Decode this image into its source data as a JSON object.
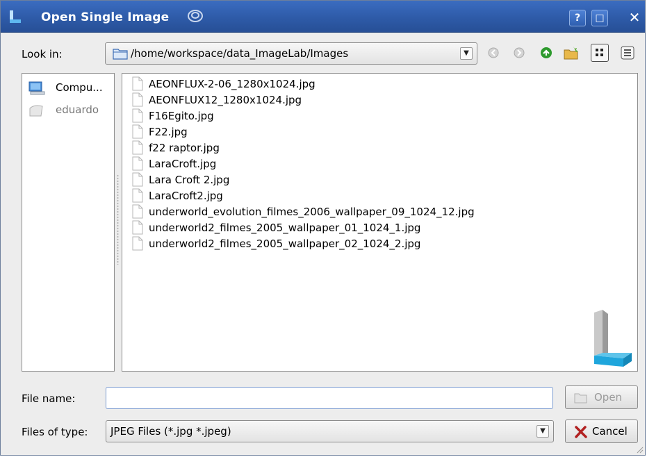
{
  "window": {
    "title": "Open Single Image",
    "help_glyph": "?",
    "max_glyph": "□",
    "close_glyph": "✕"
  },
  "lookin": {
    "label": "Look in:",
    "path": "/home/workspace/data_ImageLab/Images",
    "arrow": "▼"
  },
  "sidebar": {
    "items": [
      {
        "label": "Compu...",
        "icon": "computer-icon"
      },
      {
        "label": "eduardo",
        "icon": "home-folder-icon"
      }
    ]
  },
  "files": [
    "AEONFLUX-2-06_1280x1024.jpg",
    "AEONFLUX12_1280x1024.jpg",
    "F16Egito.jpg",
    "F22.jpg",
    "f22 raptor.jpg",
    "LaraCroft.jpg",
    "Lara Croft 2.jpg",
    "LaraCroft2.jpg",
    "underworld_evolution_filmes_2006_wallpaper_09_1024_12.jpg",
    "underworld2_filmes_2005_wallpaper_01_1024_1.jpg",
    "underworld2_filmes_2005_wallpaper_02_1024_2.jpg"
  ],
  "form": {
    "filename_label": "File name:",
    "filename_value": "",
    "filetype_label": "Files of type:",
    "filetype_value": "JPEG Files (*.jpg *.jpeg)",
    "filetype_arrow": "▼"
  },
  "buttons": {
    "open": "Open",
    "cancel": "Cancel"
  },
  "colors": {
    "titlebar": "#2e5ba8",
    "nav_up_green": "#2e9a2e",
    "cancel_red": "#b22222"
  }
}
